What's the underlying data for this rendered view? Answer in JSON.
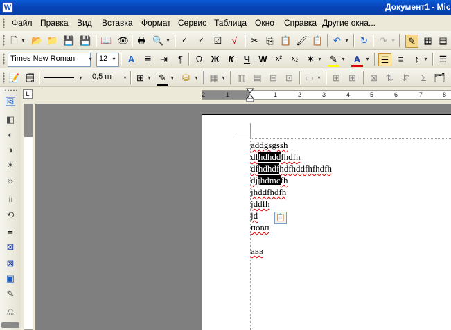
{
  "window": {
    "title": "Документ1 - Mic",
    "app_icon_letter": "W"
  },
  "menu": [
    "Файл",
    "Правка",
    "Вид",
    "Вставка",
    "Формат",
    "Сервис",
    "Таблица",
    "Окно",
    "Справка",
    "Другие окна..."
  ],
  "formatting": {
    "font_name": "Times New Roman",
    "font_size": "12",
    "bold_glyph": "Ж",
    "italic_glyph": "К",
    "underline_glyph": "Ч"
  },
  "drawing": {
    "line_width": "0,5 пт"
  },
  "ruler": {
    "corner_glyph": "L",
    "numbers": [
      "2",
      "1",
      "1",
      "2",
      "3",
      "4",
      "5",
      "6",
      "7",
      "8"
    ]
  },
  "document": {
    "lines": [
      {
        "parts": [
          {
            "text": "addgsgssh",
            "style": "sq"
          }
        ]
      },
      {
        "parts": [
          {
            "text": "df",
            "style": "sq"
          },
          {
            "text": "hdhdd",
            "style": "sel"
          },
          {
            "text": "fhdfh",
            "style": "sq"
          }
        ]
      },
      {
        "parts": [
          {
            "text": "df",
            "style": "sq"
          },
          {
            "text": "hdhdf",
            "style": "sel"
          },
          {
            "text": "hdfhddfhfhdfh",
            "style": "sq"
          }
        ]
      },
      {
        "parts": [
          {
            "text": "dj",
            "style": "sq"
          },
          {
            "text": "jhdmc",
            "style": "sel"
          },
          {
            "text": "fh",
            "style": "sq"
          }
        ]
      },
      {
        "parts": [
          {
            "text": "jhddfhdfh",
            "style": "sq"
          }
        ]
      },
      {
        "parts": [
          {
            "text": "jddfh",
            "style": "sq"
          }
        ]
      },
      {
        "parts": [
          {
            "text": "jd",
            "style": "sq"
          }
        ]
      },
      {
        "parts": [
          {
            "text": "повп",
            "style": "sq"
          }
        ]
      },
      {
        "parts": [
          {
            "text": "",
            "style": ""
          }
        ]
      },
      {
        "parts": [
          {
            "text": "авв",
            "style": "sq"
          }
        ]
      }
    ]
  },
  "colors": {
    "titlebar": "#0a4fc8",
    "highlight": "#ffff00",
    "font_color": "#e00000",
    "selection": "#000000"
  }
}
